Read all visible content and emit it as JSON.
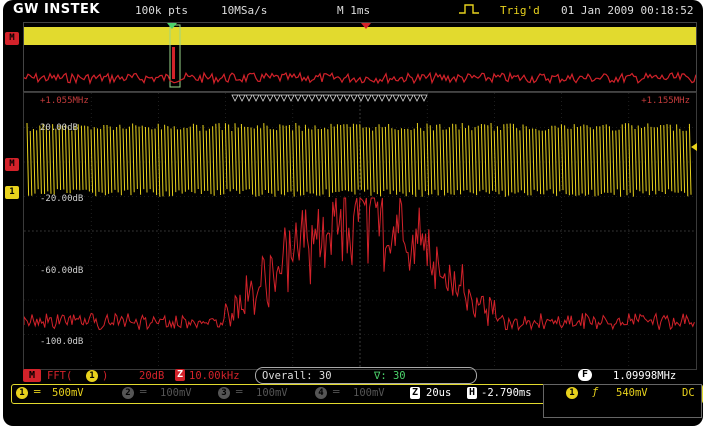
{
  "header": {
    "brand": "GW INSTEK",
    "record_length": "100k pts",
    "sample_rate": "10MSa/s",
    "timebase": "M 1ms",
    "trigger_status": "Trig'd",
    "datetime": "01 Jan 2009 00:18:52"
  },
  "side_tags": {
    "math_top": "M",
    "math_main": "M",
    "ch1": "1"
  },
  "spectrum": {
    "start_freq": "+1.055MHz",
    "stop_freq": "+1.155MHz",
    "db_labels": [
      "20.00dB",
      "-20.00dB",
      "-60.00dB",
      "-100.0dB"
    ]
  },
  "math_status": {
    "math_tag": "M",
    "function": "FFT(",
    "source": "1",
    "close_paren": ")",
    "scale": "20dB",
    "zoom_tag": "Z",
    "zoom_span": "10.00kHz",
    "overall_label": "Overall: 30",
    "delta_label": "∇: 30",
    "freq_tag": "F",
    "freq_readout": "1.09998MHz"
  },
  "channels": [
    {
      "num": "1",
      "coupling": "═",
      "volts": "500mV",
      "active": true
    },
    {
      "num": "2",
      "coupling": "═",
      "volts": "100mV",
      "active": false
    },
    {
      "num": "3",
      "coupling": "═",
      "volts": "100mV",
      "active": false
    },
    {
      "num": "4",
      "coupling": "═",
      "volts": "100mV",
      "active": false
    }
  ],
  "horizontal": {
    "zoom_tag": "Z",
    "zoom_time": "20us",
    "pos_tag": "H",
    "position": "-2.790ms"
  },
  "trigger": {
    "source": "1",
    "slope": "ƒ",
    "level": "540mV",
    "coupling": "DC"
  },
  "colors": {
    "ch1": "#e8d21d",
    "math": "#d3222a",
    "background": "#000000",
    "grid": "#333333"
  }
}
